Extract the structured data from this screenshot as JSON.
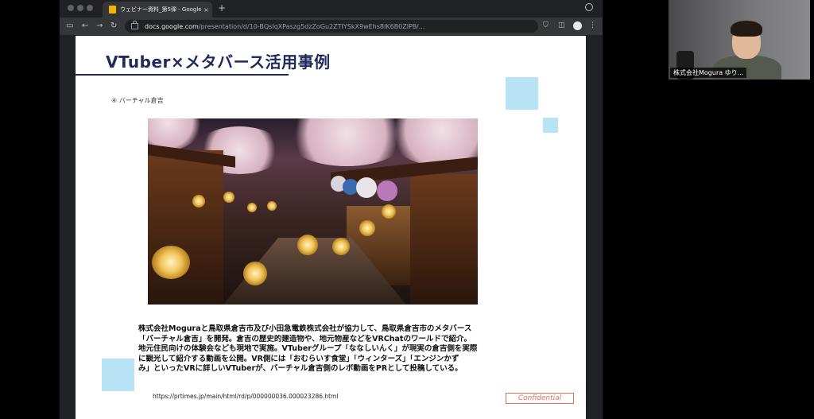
{
  "browser": {
    "tab_title": "ウェビナー資料_第5弾 - Google",
    "tab_close": "×",
    "new_tab": "+",
    "url_host": "docs.google.com",
    "url_path": "/presentation/d/10-BQsIqXPaszg5dzZoGu2ZTIYSkX9wEhs8IK6B0ZIP8/..."
  },
  "slide": {
    "title": "VTuber×メタバース活用事例",
    "subtitle": "④ バーチャル倉吉",
    "paragraph_lines": [
      "株式会社Moguraと鳥取県倉吉市及び小田急電鉄株式会社が協力して、鳥取県倉吉市のメタバース",
      "「バーチャル倉吉」を開発。倉吉の歴史的建造物や、地元物産などをVRChatのワールドで紹介。",
      "地元住民向けの体験会なども現地で実施。VTuberグループ「ななしいんく」が現実の倉吉側を実際",
      "に観光して紹介する動画を公開。VR側には「おむらいす食堂」「ウィンターズ」「エンジンかず",
      "み」といったVRに詳しいVTuberが、バーチャル倉吉側のレポ動画をPRとして投稿している。"
    ],
    "source_url": "https://prtimes.jp/main/html/rd/p/000000036.000023286.html",
    "badge": "Confidential"
  },
  "participant": {
    "name": "株式会社Mogura ゆり..."
  },
  "colors": {
    "title": "#1f2a5a",
    "accent_square": "#b7e3f5",
    "confidential": "#e07060"
  }
}
